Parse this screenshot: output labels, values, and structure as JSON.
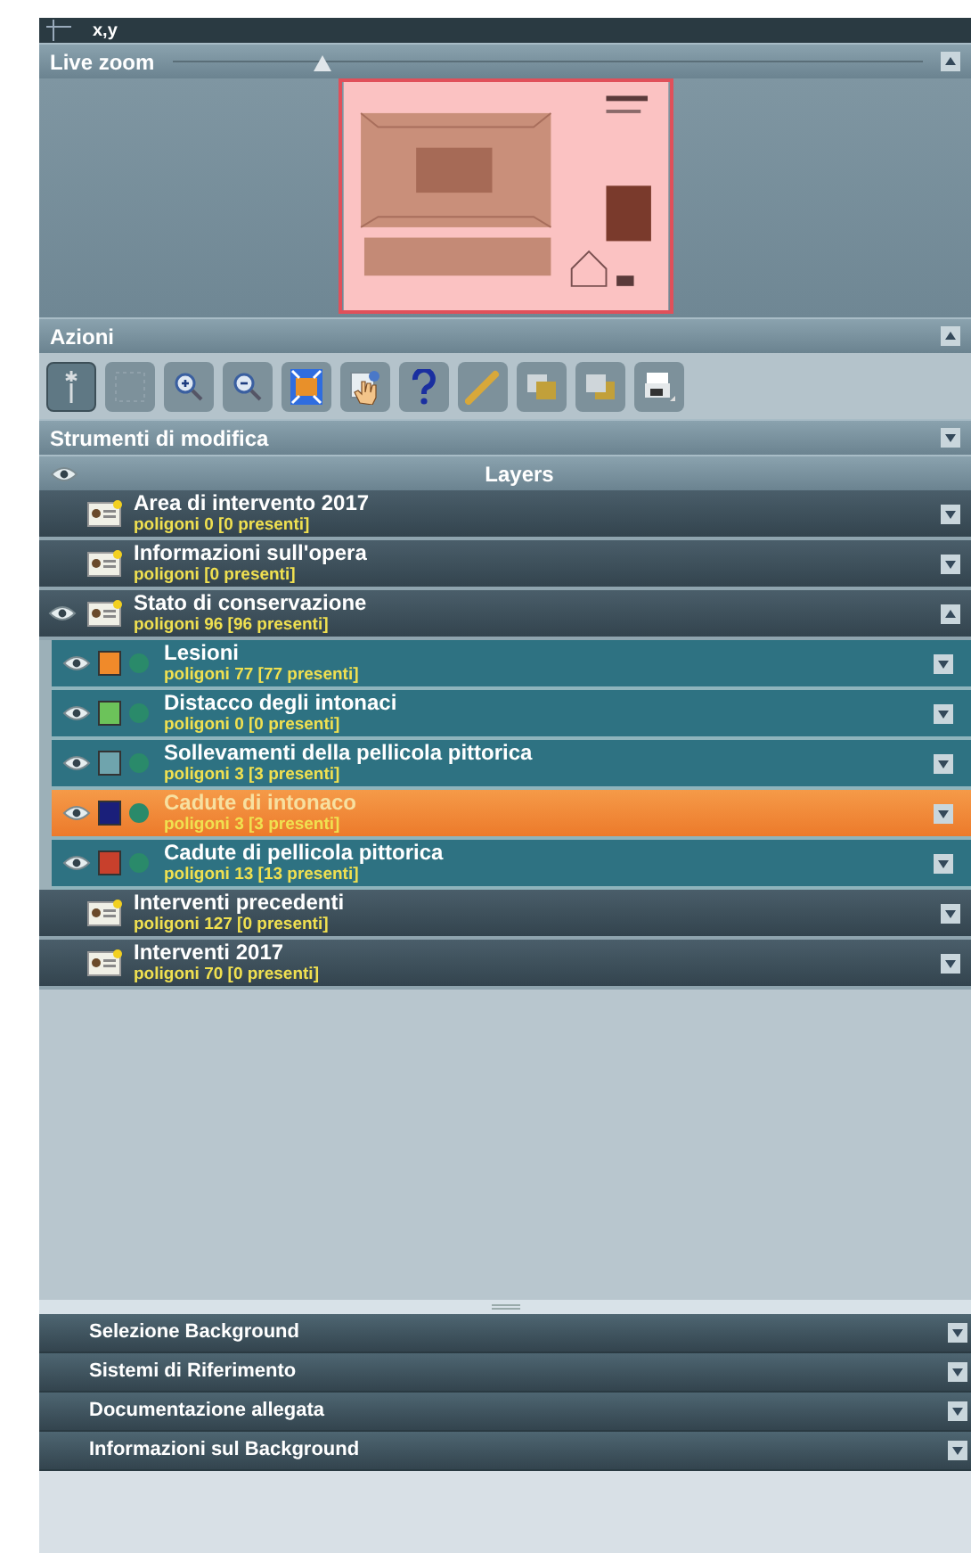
{
  "coord_bar": {
    "label": "x,y"
  },
  "live_zoom": {
    "title": "Live zoom",
    "level": 0.2,
    "expanded": true
  },
  "actions": {
    "title": "Azioni",
    "expanded": true,
    "tools": [
      {
        "kind": "pointer",
        "selected": true
      },
      {
        "kind": "select",
        "selected": false
      },
      {
        "kind": "zoom-in",
        "selected": false
      },
      {
        "kind": "zoom-out",
        "selected": false
      },
      {
        "kind": "extent",
        "selected": false
      },
      {
        "kind": "pan",
        "selected": false
      },
      {
        "kind": "help",
        "selected": false
      },
      {
        "kind": "ruler",
        "selected": false
      },
      {
        "kind": "layer-up",
        "selected": false
      },
      {
        "kind": "layer-down",
        "selected": false
      },
      {
        "kind": "print",
        "selected": false
      }
    ]
  },
  "edit_tools": {
    "title": "Strumenti di modifica",
    "expanded": false
  },
  "layers": {
    "title": "Layers",
    "items": [
      {
        "name": "Area di intervento 2017",
        "count": "poligoni 0 [0 presenti]",
        "visible": false,
        "selected": false,
        "expanded": false
      },
      {
        "name": "Informazioni sull'opera",
        "count": "poligoni  [0 presenti]",
        "visible": false,
        "selected": false,
        "expanded": false
      },
      {
        "name": "Stato di conservazione",
        "count": "poligoni 96 [96 presenti]",
        "visible": true,
        "selected": false,
        "expanded": true,
        "children": [
          {
            "name": "Lesioni",
            "count": "poligoni 77 [77 presenti]",
            "visible": true,
            "selected": false,
            "color": "#f08a2a"
          },
          {
            "name": "Distacco degli intonaci",
            "count": "poligoni 0 [0 presenti]",
            "visible": true,
            "selected": false,
            "color": "#6cc35a"
          },
          {
            "name": "Sollevamenti della pellicola pittorica",
            "count": "poligoni 3 [3 presenti]",
            "visible": true,
            "selected": false,
            "color": "#6fa4ad"
          },
          {
            "name": "Cadute di intonaco",
            "count": "poligoni 3 [3 presenti]",
            "visible": true,
            "selected": true,
            "color": "#1a1f7a"
          },
          {
            "name": "Cadute di pellicola pittorica",
            "count": "poligoni 13 [13 presenti]",
            "visible": true,
            "selected": false,
            "color": "#c8402c"
          }
        ]
      },
      {
        "name": "Interventi precedenti",
        "count": "poligoni 127 [0 presenti]",
        "visible": false,
        "selected": false,
        "expanded": false
      },
      {
        "name": "Interventi 2017",
        "count": "poligoni 70 [0 presenti]",
        "visible": false,
        "selected": false,
        "expanded": false
      }
    ]
  },
  "bottom_sections": [
    {
      "title": "Selezione Background",
      "expanded": false
    },
    {
      "title": "Sistemi di Riferimento",
      "expanded": false
    },
    {
      "title": "Documentazione allegata",
      "expanded": false
    },
    {
      "title": "Informazioni sul Background",
      "expanded": false
    }
  ]
}
